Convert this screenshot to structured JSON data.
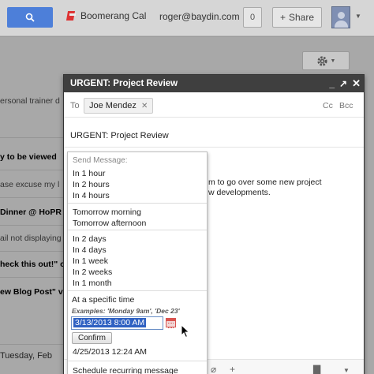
{
  "topbar": {
    "app_name": "Boomerang Cal",
    "email": "roger@baydin.com",
    "count": "0",
    "share_label": "Share"
  },
  "inbox_snippets": [
    "ersonal trainer d",
    "y to be viewed",
    "ase excuse my l",
    "Dinner @ HoPR",
    "ail not displaying",
    "heck this out!\" c",
    "ew Blog Post\" via",
    "Tuesday, Feb"
  ],
  "compose": {
    "title": "URGENT: Project Review",
    "to_label": "To",
    "recipient": "Joe Mendez",
    "cc_label": "Cc",
    "bcc_label": "Bcc",
    "subject": "URGENT: Project Review",
    "body_line1": "m to go over some new project",
    "body_line2": "w developments."
  },
  "send_later_menu": {
    "heading": "Send Message:",
    "group1": [
      "In 1 hour",
      "In 2 hours",
      "In 4 hours"
    ],
    "group2": [
      "Tomorrow morning",
      "Tomorrow afternoon"
    ],
    "group3": [
      "In 2 days",
      "In 4 days",
      "In 1 week",
      "In 2 weeks",
      "In 1 month"
    ],
    "specific_time_label": "At a specific time",
    "examples": "Examples: 'Monday 9am', 'Dec 23'",
    "datetime_value": "3/13/2013 8:00 AM",
    "confirm_label": "Confirm",
    "last_time": "4/25/2013 12:24 AM",
    "recurring_label": "Schedule recurring message"
  },
  "colors": {
    "search_button": "#4d7fd9",
    "compose_header": "#3f3f3f",
    "selection": "#2f61c2",
    "boomerang_red": "#d33333"
  }
}
